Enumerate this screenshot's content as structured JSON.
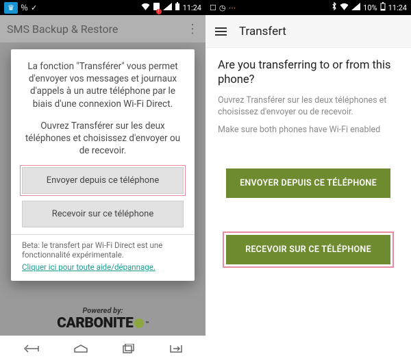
{
  "left": {
    "status": {
      "time": "11:24",
      "icons": [
        "crown-icon",
        "percent-icon",
        "check-icon",
        "wifi-icon",
        "sim-error-icon",
        "signal-icon",
        "battery-icon"
      ]
    },
    "appbar": {
      "title": "SMS Backup & Restore"
    },
    "dialog": {
      "para1": "La fonction \"Transférer\" vous permet d'envoyer vos messages et journaux d'appels à un autre téléphone par le biais d'une connexion Wi-Fi Direct.",
      "para2": "Ouvrez Transférer sur les deux téléphones et choisissez d'envoyer ou de recevoir.",
      "send_button": "Envoyer depuis ce téléphone",
      "receive_button": "Recevoir sur ce téléphone",
      "beta_text": "Beta: le transfert par Wi-Fi Direct est une fonctionnalité expérimentale.",
      "help_link": "Cliquer ici pour toute aide/dépannage."
    },
    "footer": {
      "powered_by": "Powered by:",
      "brand": "CARBONITE"
    },
    "nav": [
      "back-icon",
      "home-icon",
      "recent-icon",
      "transfer-icon"
    ]
  },
  "right": {
    "status": {
      "time": "11:24",
      "battery_text": "10%",
      "icons": [
        "clock-icon",
        "loading-icon",
        "bluetooth-icon",
        "wifi-icon",
        "signal-icon",
        "battery-icon"
      ]
    },
    "appbar": {
      "title": "Transfert"
    },
    "content": {
      "question": "Are you transferring to or from this phone?",
      "sub1": "Ouvrez Transférer sur les deux téléphones et choisissez d'envoyer ou de recevoir.",
      "sub2": "Make sure both phones have Wi-Fi enabled",
      "send_button": "ENVOYER DEPUIS CE TÉLÉPHONE",
      "receive_button": "RECEVOIR SUR CE TÉLÉPHONE"
    }
  }
}
